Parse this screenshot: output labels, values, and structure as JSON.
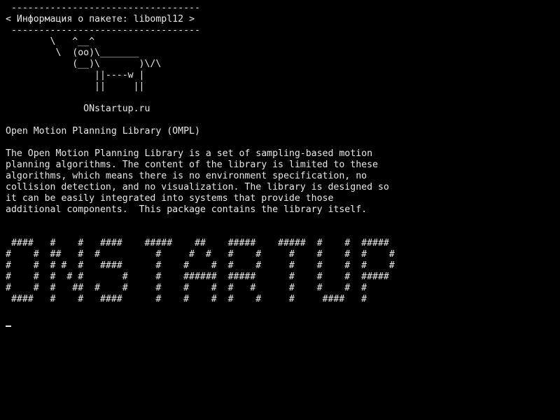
{
  "banner": {
    "top_border": " ----------------------------------",
    "title": "< Информация о пакете: libompl12 >",
    "bottom_border": " ----------------------------------"
  },
  "cow": {
    "line1": "        \\   ^__^",
    "line2": "         \\  (oo)\\_______",
    "line3": "            (__)\\       )\\/\\",
    "line4": "                ||----w |",
    "line5": "                ||     ||",
    "signature": "              ONstartup.ru"
  },
  "package": {
    "name": "Open Motion Planning Library (OMPL)",
    "description": [
      "The Open Motion Planning Library is a set of sampling-based motion",
      "planning algorithms. The content of the library is limited to these",
      "algorithms, which means there is no environment specification, no",
      "collision detection, and no visualization. The library is designed so",
      "it can be easily integrated into systems that provide those",
      "additional components.  This package contains the library itself."
    ]
  },
  "ascii_banner": [
    " ####   #    #   ####    #####    ##    #####    #####  #    #  #####",
    "#    #  ##   #  #          #     #  #   #    #     #    #    #  #    #",
    "#    #  # #  #   ####      #    #    #  #    #     #    #    #  #    #",
    "#    #  #  # #       #     #    ######  #####      #    #    #  #####",
    "#    #  #   ##  #    #     #    #    #  #   #      #    #    #  #",
    " ####   #    #   ####      #    #    #  #    #     #     ####   #"
  ]
}
